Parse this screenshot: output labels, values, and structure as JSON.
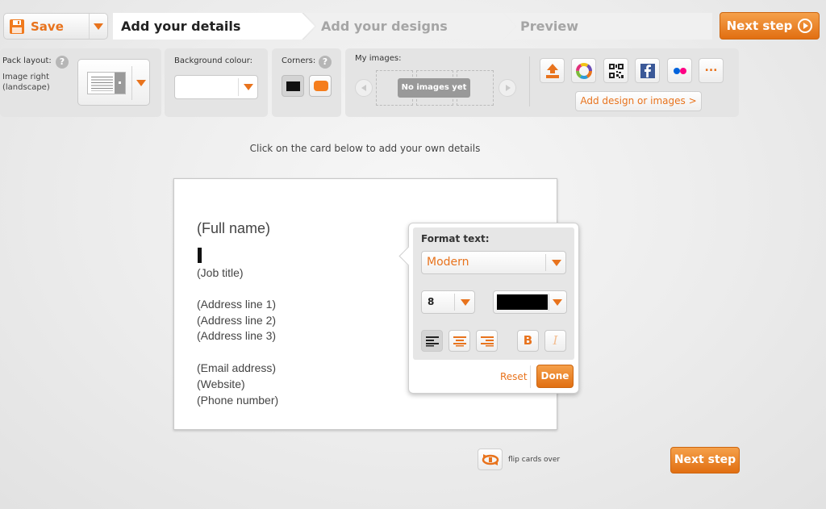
{
  "header": {
    "save_label": "Save",
    "steps": [
      {
        "label": "Add your details",
        "active": true
      },
      {
        "label": "Add your designs",
        "active": false
      },
      {
        "label": "Preview",
        "active": false
      }
    ],
    "next_label": "Next step"
  },
  "toolbar": {
    "pack_layout": {
      "label": "Pack layout:",
      "help": "?",
      "value_line1": "Image right",
      "value_line2": "(landscape)"
    },
    "background": {
      "label": "Background colour:",
      "value_color": "#ffffff"
    },
    "corners": {
      "label": "Corners:",
      "help": "?",
      "options": [
        "square",
        "rounded"
      ],
      "selected": "square"
    },
    "images": {
      "label": "My images:",
      "empty_text": "No images yet"
    },
    "sources": [
      {
        "icon": "upload-icon"
      },
      {
        "icon": "color-wheel-icon"
      },
      {
        "icon": "qr-code-icon"
      },
      {
        "icon": "facebook-icon"
      },
      {
        "icon": "flickr-icon"
      },
      {
        "icon": "more-icon",
        "label": "..."
      }
    ],
    "add_design_label": "Add design or images >"
  },
  "main": {
    "hint": "Click on the card below to add your own details",
    "card": {
      "full_name": "(Full name)",
      "job_title": "(Job title)",
      "address_1": "(Address line 1)",
      "address_2": "(Address line 2)",
      "address_3": "(Address line 3)",
      "email": "(Email address)",
      "website": "(Website)",
      "phone": "(Phone number)"
    },
    "format_text": {
      "title": "Format text:",
      "font": "Modern",
      "size": "8",
      "color": "#000000",
      "align": "left",
      "bold_label": "B",
      "italic_label": "I",
      "reset_label": "Reset",
      "done_label": "Done"
    },
    "flip_label": "flip cards over",
    "next_label": "Next step"
  },
  "colors": {
    "accent": "#e8731d",
    "accent_light": "#f5a04a"
  }
}
